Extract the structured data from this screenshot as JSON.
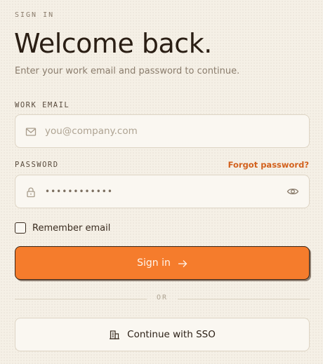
{
  "header": {
    "eyebrow": "SIGN IN",
    "title": "Welcome back.",
    "subtitle": "Enter your work email and password to continue."
  },
  "email": {
    "label": "WORK EMAIL",
    "placeholder": "you@company.com",
    "value": "",
    "icon": "mail-icon"
  },
  "password": {
    "label": "PASSWORD",
    "forgot_link": "Forgot password?",
    "value": "••••••••••••",
    "icon": "lock-icon",
    "toggle_icon": "eye-icon"
  },
  "remember": {
    "label": "Remember email",
    "checked": false
  },
  "actions": {
    "signin_label": "Sign in",
    "divider_label": "OR",
    "sso_label": "Continue with SSO"
  },
  "colors": {
    "background": "#f5f0e6",
    "accent": "#f57c2c",
    "link": "#d2601c",
    "text": "#2a1e14",
    "muted": "#8a7c6c"
  }
}
